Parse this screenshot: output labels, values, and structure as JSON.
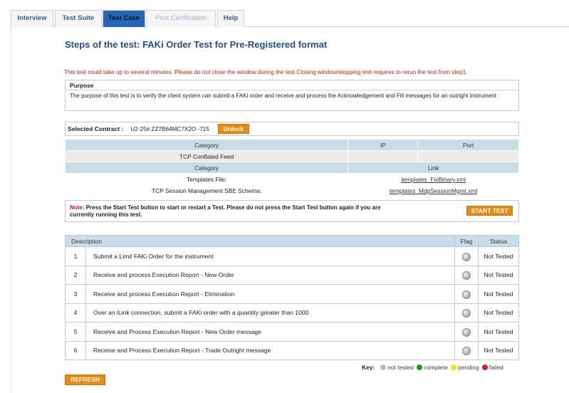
{
  "tabs": [
    {
      "label": "Interview",
      "state": "normal"
    },
    {
      "label": "Test Suite",
      "state": "normal"
    },
    {
      "label": "Test Case",
      "state": "active"
    },
    {
      "label": "Post Certification",
      "state": "disabled"
    },
    {
      "label": "Help",
      "state": "normal"
    }
  ],
  "page": {
    "title": "Steps of the test: FAKi Order Test for Pre-Registered format",
    "warning": "This test could take up to several minutes. Please do not close the window during the test.Closing window/stopping test requires to rerun the test from step1."
  },
  "purpose": {
    "heading": "Purpose",
    "text": "The purpose of this test is to verify the client system can submit a FAKi order and receive and process the Acknowledgement and Fill messages for an outright instrument"
  },
  "contract": {
    "label": "Selected Contract :",
    "value": "U2-25#.ZZ7B64MC7X2O -715",
    "unlock_label": "Unlock"
  },
  "connection": {
    "headers": {
      "category": "Category",
      "ip": "IP",
      "port": "Port"
    },
    "row": {
      "category": "TCP Conflated Feed",
      "ip": "",
      "port": ""
    },
    "files_headers": {
      "category": "Category",
      "link": "Link"
    },
    "files": [
      {
        "category": "Templates File:",
        "link": "templates_FixBinary.xml"
      },
      {
        "category": "TCP Session Management SBE Schema:",
        "link": "templates_MdpSessionMgmt.xml"
      }
    ]
  },
  "note": {
    "label": "Note:",
    "text": "Press the Start Test button to start or restart a Test. Please do not press the Start Test button again if you are currently running this test.",
    "start_label": "START TEST"
  },
  "steps": {
    "headers": {
      "description": "Description",
      "flag": "Flag",
      "status": "Status"
    },
    "rows": [
      {
        "num": "1",
        "description": "Submit a Limit FAKi Order for the instrument",
        "status": "Not Tested"
      },
      {
        "num": "2",
        "description": "Receive and process Execution Report - New Order",
        "status": "Not Tested"
      },
      {
        "num": "3",
        "description": "Receive and process Execution Report - Elimination",
        "status": "Not Tested"
      },
      {
        "num": "4",
        "description": "Over an iLink connection, submit a FAKi order with a quantity greater than 1000",
        "status": "Not Tested"
      },
      {
        "num": "5",
        "description": "Receive and Process Execution Report - New Order message",
        "status": "Not Tested"
      },
      {
        "num": "6",
        "description": "Receive and Process Execution Report - Trade Outright message",
        "status": "Not Tested"
      }
    ]
  },
  "key": {
    "label": "Key:",
    "items": [
      {
        "label": "not tested",
        "color": "#bdbdbd"
      },
      {
        "label": "complete",
        "color": "#1f9a1f"
      },
      {
        "label": "pending",
        "color": "#f3e21b"
      },
      {
        "label": "failed",
        "color": "#e01b1b"
      }
    ]
  },
  "refresh_label": "REFRESH",
  "colors": {
    "accent": "#2467b8",
    "button": "#e78b12",
    "warning": "#cc1b1b",
    "title": "#1f4e8c",
    "table_header": "#c9dcea"
  }
}
